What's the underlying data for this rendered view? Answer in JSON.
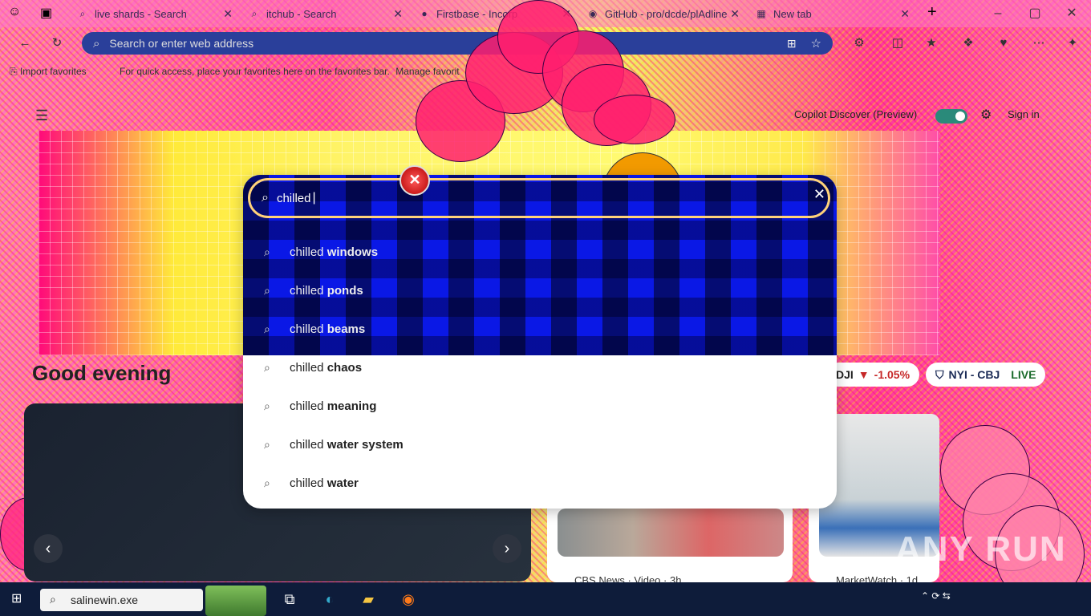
{
  "tabs": [
    {
      "label": "live shards - Search",
      "icon": "search-icon"
    },
    {
      "label": "itchub - Search",
      "icon": "search-icon"
    },
    {
      "label": "Firstbase - Incorp",
      "icon": "firstbase-icon"
    },
    {
      "label": "GitHub - pro/dcde/plAdline",
      "icon": "github-icon"
    },
    {
      "label": "New tab",
      "icon": "newtab-icon"
    }
  ],
  "address_bar": {
    "placeholder": "Search or enter web address"
  },
  "favorites": {
    "import": "Import favorites",
    "hint": "For quick access, place your favorites here on the favorites bar.",
    "manage": "Manage favorit"
  },
  "ntp": {
    "discover_label": "Copilot Discover (Preview)",
    "sign_in": "Sign in"
  },
  "search": {
    "query": "chilled",
    "suggestions": [
      {
        "prefix": "chilled ",
        "suffix": "windows"
      },
      {
        "prefix": "chilled ",
        "suffix": "ponds"
      },
      {
        "prefix": "chilled ",
        "suffix": "beams"
      },
      {
        "prefix": "chilled ",
        "suffix": "chaos"
      },
      {
        "prefix": "chilled ",
        "suffix": "meaning"
      },
      {
        "prefix": "chilled ",
        "suffix": "water system"
      },
      {
        "prefix": "chilled ",
        "suffix": "water"
      }
    ]
  },
  "greeting": "Good evening",
  "tickers": [
    {
      "symbol": "DJI",
      "change": "-1.05%",
      "color": "#c62828"
    },
    {
      "match": "NYI - CBJ",
      "status": "LIVE"
    }
  ],
  "news": [
    {
      "source": "CBS News · Video · 3h"
    },
    {
      "source": "MarketWatch · 1d"
    }
  ],
  "taskbar": {
    "search_text": "salinewin.exe"
  },
  "watermark": "ANY RUN"
}
